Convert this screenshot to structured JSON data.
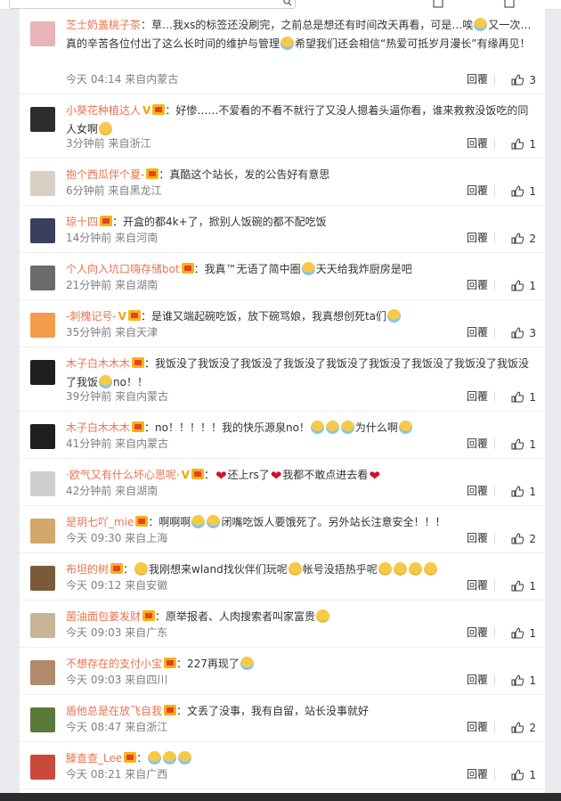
{
  "reply_label": "回覆",
  "comments": [
    {
      "user": "芝士奶盖桃子茶",
      "vip": false,
      "fan": false,
      "text": "：草…我xs的标签还没刷完，之前总是想还有时间改天再看，可是…唉",
      "emoji_after": "cry",
      "text2": "又一次…真的辛苦各位付出了这么长时间的维护与管理",
      "emoji_after2": "sob",
      "text3": "希望我们还会相信“热爱可抵岁月漫长”有缘再见！",
      "time": "今天 04:14",
      "from": "来自内蒙古",
      "likes": "3",
      "avatar": "#e8b4b8"
    },
    {
      "user": "小葵花种植达人",
      "vip": true,
      "fan": true,
      "text": "：好惨……不爱看的不看不就行了又没人摁着头逼你看，谁来救救没饭吃的同人女啊",
      "emoji_after": "doge",
      "time": "3分钟前",
      "from": "来自浙江",
      "likes": "1",
      "avatar": "#2d2d2d"
    },
    {
      "user": "抱个西瓜伴个夏-",
      "vip": false,
      "fan": true,
      "text": "：真酷这个站长，发的公告好有意思",
      "time": "6分钟前",
      "from": "来自黑龙江",
      "likes": "1",
      "avatar": "#d9cfc4"
    },
    {
      "user": "琼十四",
      "vip": false,
      "fan": true,
      "text": "：开盒的都4k+了，掀别人饭碗的都不配吃饭",
      "time": "14分钟前",
      "from": "来自河南",
      "likes": "2",
      "avatar": "#3a3f5c"
    },
    {
      "user": "个人向入坑口嗨存储bot",
      "vip": false,
      "fan": true,
      "text": "：我真™无语了简中圈",
      "emoji_after": "sob",
      "text2": "天天给我炸厨房是吧",
      "time": "21分钟前",
      "from": "来自湖南",
      "likes": "1",
      "avatar": "#6b6b6b"
    },
    {
      "user": "-刺槐记号-",
      "vip": true,
      "fan": true,
      "text": "：是谁又端起碗吃饭，放下碗骂娘，我真想创死ta们",
      "emoji_after": "sob",
      "time": "35分钟前",
      "from": "来自天津",
      "likes": "3",
      "avatar": "#f29d4b"
    },
    {
      "user": "木子白木木木",
      "vip": false,
      "fan": true,
      "text": "：我饭没了我饭没了我饭没了我饭没了我饭没了我饭没了我饭没了我饭没了我饭没了我饭",
      "emoji_after": "cry",
      "text2": "no！！",
      "time": "39分钟前",
      "from": "来自内蒙古",
      "likes": "1",
      "avatar": "#1f1f1f"
    },
    {
      "user": "木子白木木木",
      "vip": false,
      "fan": true,
      "text": "：no！！！！！我的快乐源泉no！",
      "emoji_triple": "cry",
      "text2": "为什么啊",
      "time": "41分钟前",
      "from": "来自内蒙古",
      "likes": "1",
      "avatar": "#1f1f1f"
    },
    {
      "user": "·欧气又有什么坏心思呢·",
      "vip": true,
      "fan": true,
      "text": "",
      "heart": true,
      "text2": "还上rs了",
      "text3": "我都不敢点进去看",
      "time": "42分钟前",
      "from": "来自湖南",
      "likes": "1",
      "avatar": "#cfcfcf"
    },
    {
      "user": "是玥七吖_mie",
      "vip": false,
      "fan": true,
      "text": "：啊啊啊",
      "emoji_after": "sob",
      "text2": "闭嘴吃饭人要饿死了。另外站长注意安全！！！",
      "time": "今天 09:30",
      "from": "来自上海",
      "likes": "2",
      "avatar": "#d4a86a"
    },
    {
      "user": "布坦的树",
      "vip": false,
      "fan": true,
      "text": "：",
      "emoji_after": "sad",
      "text2": "我刚想来wland找伙伴们玩呢",
      "text3": "帐号没捂热乎呢",
      "time": "今天 09:12",
      "from": "来自安徽",
      "likes": "1",
      "avatar": "#7a5a3a"
    },
    {
      "user": "菌油面包姜发财",
      "vip": false,
      "fan": true,
      "text": "：原举报者、人肉搜索者叫家富贵",
      "time": "今天 09:03",
      "from": "来自广东",
      "likes": "1",
      "avatar": "#c8b496"
    },
    {
      "user": "不想存在的支付小宝",
      "vip": false,
      "fan": true,
      "text": "：227再现了",
      "time": "今天 09:03",
      "from": "来自四川",
      "likes": "1",
      "avatar": "#b08a6a"
    },
    {
      "user": "盾他总是在放飞自我",
      "vip": false,
      "fan": true,
      "text": "：文丢了没事，我有自留，站长没事就好",
      "time": "今天 08:47",
      "from": "来自浙江",
      "likes": "2",
      "avatar": "#5a7a3a"
    },
    {
      "user": "滕查查_Lee",
      "vip": false,
      "fan": true,
      "text": "：",
      "time": "今天 08:21",
      "from": "来自广西",
      "likes": "1",
      "avatar": "#c94a3a"
    }
  ]
}
